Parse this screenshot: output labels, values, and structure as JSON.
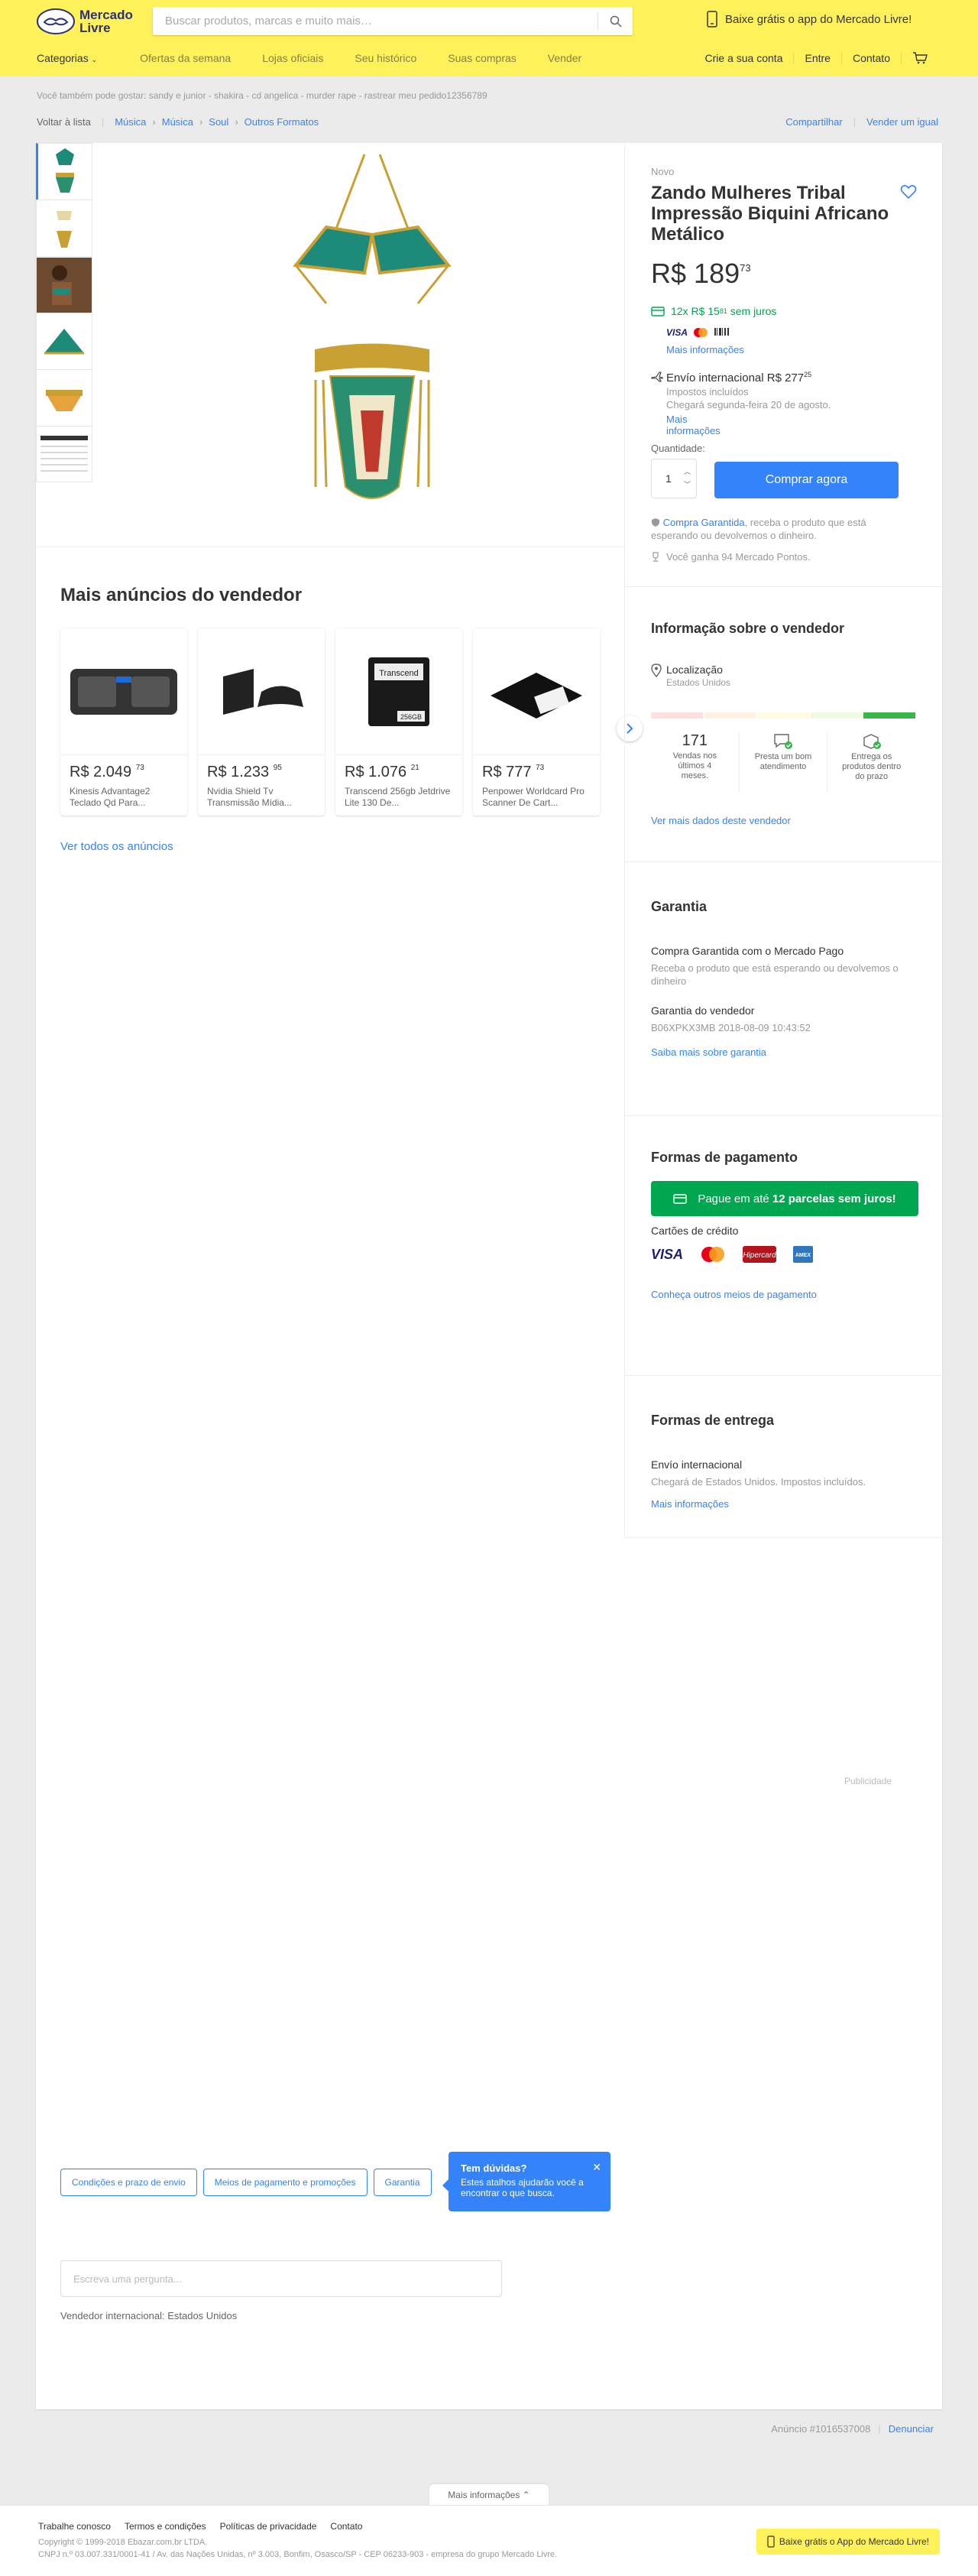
{
  "header": {
    "logo_line1": "Mercado",
    "logo_line2": "Livre",
    "search_placeholder": "Buscar produtos, marcas e muito mais…",
    "app_banner": "Baixe grátis o app do Mercado Livre!",
    "nav": [
      "Categorias",
      "Ofertas da semana",
      "Lojas oficiais",
      "Seu histórico",
      "Suas compras",
      "Vender"
    ],
    "nav_right": [
      "Crie a sua conta",
      "Entre",
      "Contato"
    ]
  },
  "also_searched": "Você também pode gostar: sandy e junior - shakira - cd angelica - murder rape - rastrear meu pedido12356789",
  "breadcrumb": {
    "back": "Voltar à lista",
    "items": [
      "Música",
      "Música",
      "Soul",
      "Outros Formatos"
    ],
    "share": "Compartilhar",
    "sell_similar": "Vender um igual"
  },
  "product": {
    "condition": "Novo",
    "title": "Zando Mulheres Tribal Impressão Biquini Africano Metálico",
    "price_currency": "R$",
    "price_int": "189",
    "price_cents": "73",
    "installments_prefix": "12x R$ 15",
    "installments_cents": "81",
    "installments_suffix": "sem juros",
    "more_info": "Mais informações",
    "shipping_title_prefix": "Envío internacional R$ 277",
    "shipping_cents": "25",
    "shipping_taxes": "Impostos incluídos",
    "shipping_arrival": "Chegará segunda-feira 20 de agosto.",
    "shipping_more": "Mais informações",
    "quantity_label": "Quantidade:",
    "quantity_value": "1",
    "buy_now": "Comprar agora",
    "guarantee_link": "Compra Garantida",
    "guarantee_text": ", receba o produto que está esperando ou devolvemos o dinheiro.",
    "points": "Você ganha 94 Mercado Pontos."
  },
  "seller": {
    "heading": "Informação sobre o vendedor",
    "location_label": "Localização",
    "location_value": "Estados Unidos",
    "sales_num": "171",
    "sales_label": "Vendas nos últimos 4 meses.",
    "service_label": "Presta um bom atendimento",
    "delivery_label": "Entrega os produtos dentro do prazo",
    "more_data": "Ver mais dados deste vendedor"
  },
  "guarantee": {
    "heading": "Garantia",
    "mp_title": "Compra Garantida com o Mercado Pago",
    "mp_text": "Receba o produto que está esperando ou devolvemos o dinheiro",
    "seller_title": "Garantia do vendedor",
    "seller_code": "B06XPKX3MB 2018-08-09 10:43:52",
    "learn_more": "Saiba mais sobre garantia"
  },
  "payment": {
    "heading": "Formas de pagamento",
    "banner_prefix": "Pague em até ",
    "banner_bold": "12 parcelas sem juros!",
    "credit_cards": "Cartões de crédito",
    "other_methods": "Conheça outros meios de pagamento"
  },
  "delivery": {
    "heading": "Formas de entrega",
    "type": "Envío internacional",
    "detail": "Chegará de Estados Unidos. Impostos incluídos.",
    "more": "Mais informações"
  },
  "advertising": "Publicidade",
  "more_ads": {
    "heading": "Mais anúncios do vendedor",
    "see_all": "Ver todos os anúncios",
    "items": [
      {
        "price": "R$ 2.049",
        "cents": "73",
        "title": "Kinesis Advantage2 Teclado Qd Para..."
      },
      {
        "price": "R$ 1.233",
        "cents": "95",
        "title": "Nvidia Shield Tv Transmissão Mídia..."
      },
      {
        "price": "R$ 1.076",
        "cents": "21",
        "title": "Transcend 256gb Jetdrive Lite 130 De..."
      },
      {
        "price": "R$ 777",
        "cents": "73",
        "title": "Penpower Worldcard Pro Scanner De Cart..."
      }
    ]
  },
  "tabs": [
    "Condições e prazo de envio",
    "Meios de pagamento e promoções",
    "Garantia"
  ],
  "tooltip": {
    "title": "Tem dúvidas?",
    "body": "Estes atalhos ajudarão você a encontrar o que busca."
  },
  "question_placeholder": "Escreva uma pergunta...",
  "international_seller": "Vendedor internacional: Estados Unidos",
  "ad_number": "Anúncio #1016537008",
  "report": "Denunciar",
  "footer": {
    "more_info": "Mais informações",
    "links": [
      "Trabalhe conosco",
      "Termos e condições",
      "Políticas de privacidade",
      "Contato"
    ],
    "copyright": "Copyright © 1999-2018 Ebazar.com.br LTDA.",
    "cnpj": "CNPJ n.º 03.007.331/0001-41 / Av. das Nações Unidas, nº 3.003, Bonfim, Osasco/SP - CEP 06233-903 - empresa do grupo Mercado Livre.",
    "app": "Baixe grátis o App do Mercado Livre!"
  },
  "colors": {
    "brand_yellow": "#fff159",
    "link_blue": "#3483fa",
    "green": "#00a650"
  }
}
